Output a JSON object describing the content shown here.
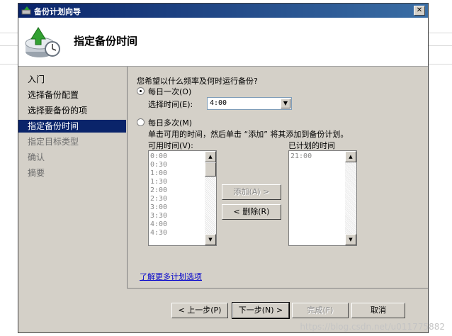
{
  "window": {
    "title": "备份计划向导",
    "close_symbol": "✕"
  },
  "header": {
    "title": "指定备份时间"
  },
  "sidebar": {
    "items": [
      {
        "label": "入门",
        "state": "done"
      },
      {
        "label": "选择备份配置",
        "state": "done"
      },
      {
        "label": "选择要备份的项",
        "state": "done"
      },
      {
        "label": "指定备份时间",
        "state": "active"
      },
      {
        "label": "指定目标类型",
        "state": "disabled"
      },
      {
        "label": "确认",
        "state": "disabled"
      },
      {
        "label": "摘要",
        "state": "disabled"
      }
    ]
  },
  "main": {
    "question": "您希望以什么频率及何时运行备份?",
    "once_label": "每日一次(O)",
    "select_time_label": "选择时间(E):",
    "select_time_value": "4:00",
    "multiple_label": "每日多次(M)",
    "instruction": "单击可用的时间，然后单击 “添加” 将其添加到备份计划。",
    "available_label": "可用时间(V):",
    "available_times": [
      "0:00",
      "0:30",
      "1:00",
      "1:30",
      "2:00",
      "2:30",
      "3:00",
      "3:30",
      "4:00",
      "4:30"
    ],
    "scheduled_label": "已计划的时间",
    "scheduled_times": [
      "21:00"
    ],
    "add_button": "添加(A) >",
    "remove_button": "< 删除(R)",
    "link": "了解更多计划选项",
    "selected_option": "once"
  },
  "footer": {
    "back": "< 上一步(P)",
    "next": "下一步(N) >",
    "finish": "完成(F)",
    "cancel": "取消"
  },
  "watermark": "https://blog.csdn.net/u011775882",
  "colors": {
    "title_start": "#0a246a",
    "title_end": "#3a6ea5",
    "face": "#d4d0c8",
    "selection": "#0a246a"
  }
}
